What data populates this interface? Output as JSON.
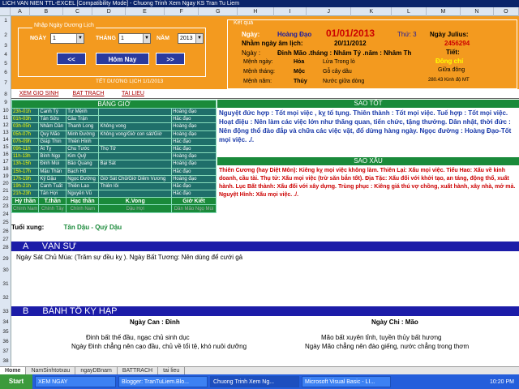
{
  "window": {
    "title": "LICH VAN NIEN TTL-EXCEL  [Compatibility Mode] - Chuong Trinh Xem Ngay KS Tran Tu Liem"
  },
  "columns": [
    "",
    "A",
    "B",
    "C",
    "D",
    "E",
    "F",
    "G",
    "H",
    "I",
    "J",
    "K",
    "L",
    "M",
    "N",
    "O"
  ],
  "rows": [
    "1",
    "2",
    "3",
    "4",
    "5",
    "6",
    "7",
    "8",
    "9",
    "10",
    "11",
    "12",
    "13",
    "14",
    "15",
    "16",
    "17",
    "18",
    "19",
    "20",
    "21",
    "22",
    "23",
    "24",
    "25",
    "26",
    "27",
    "28",
    "29",
    "30",
    "31",
    "32",
    "33",
    "34",
    "35",
    "36",
    "37",
    "38"
  ],
  "nhap": {
    "title": "Nhập Ngày Dương Lịch",
    "ngay_label": "NGÀY",
    "thang_label": "THÁNG",
    "nam_label": "NĂM",
    "ngay": "1",
    "thang": "1",
    "nam": "2013",
    "prev": "<<",
    "today": "Hôm Nay",
    "next": ">>",
    "footer": "TẾT DƯƠNG LỊCH 1/1/2013"
  },
  "ketqua": {
    "title": "Kết quả",
    "ngay_label": "Ngày:",
    "ngay_type": "Hoàng Đạo",
    "date": "01/01/2013",
    "thu": "Thứ: 3",
    "julius_label": "Ngày Julius:",
    "julius": "2456294",
    "am_label": "Nhằm ngày âm lịch:",
    "am": "20/11/2012",
    "tiet_label": "Tiết:",
    "ngay2_label": "Ngày :",
    "canchi": "Đinh Mão .tháng : Nhâm Tý .năm : Nhâm Th",
    "tiet": "Đông chí",
    "menh_ngay_label": "Mệnh ngày:",
    "menh_ngay": "Hỏa",
    "menh_ngay_v": "Lửa Trong lò",
    "giua": "Giữa đông",
    "menh_thang_label": "Mệnh tháng:",
    "menh_thang": "Mộc",
    "menh_thang_v": "Gỗ cây dâu",
    "kinhdo": "280.43 Kinh độ MT",
    "menh_nam_label": "Mệnh năm:",
    "menh_nam": "Thủy",
    "menh_nam_v": "Nước giữa dòng"
  },
  "tabs": [
    "XEM GIO SINH",
    "BAT TRACH",
    "TAI LIEU"
  ],
  "banggio": {
    "header": "BẢNG GIỜ",
    "rows": [
      [
        "23h-01h",
        "Canh Tý",
        "Tư Mệnh",
        "",
        "Hoàng đạo"
      ],
      [
        "01h-03h",
        "Tân Sửu",
        "Câu Trận",
        "",
        "Hắc đạo"
      ],
      [
        "03h-05h",
        "Nhâm Dần",
        "Thanh Long",
        "Không vong",
        "Hoàng đạo"
      ],
      [
        "05h-07h",
        "Quý Mão",
        "Minh Đường",
        "Không vong/Giờ con sát/Giờ",
        "Hoàng đạo"
      ],
      [
        "07h-09h",
        "Giáp Thìn",
        "Thiên Hình",
        "",
        "Hắc đạo"
      ],
      [
        "09h-11h",
        "Ất Tỵ",
        "Chu Tước",
        "Thọ Tử",
        "Hắc đạo"
      ],
      [
        "11h-13h",
        "Bính Ngọ",
        "Kim Quỹ",
        "",
        "Hoàng đạo"
      ],
      [
        "13h-15h",
        "Đinh Mùi",
        "Bảo Quang",
        "Bại Sát",
        "Hoàng đạo"
      ],
      [
        "15h-17h",
        "Mậu Thân",
        "Bạch Hổ",
        "",
        "Hắc đạo"
      ],
      [
        "17h-19h",
        "Kỷ Dậu",
        "Ngọc Đường",
        "Giờ Sát Chủ/Giờ Diêm Vương",
        "Hoàng đạo"
      ],
      [
        "19h-21h",
        "Canh Tuất",
        "Thiên Lao",
        "Thiên lôi",
        "Hắc đạo"
      ],
      [
        "21h-23h",
        "Tân Hợi",
        "Nguyên Vũ",
        "",
        "Hắc đạo"
      ]
    ],
    "foot": [
      "Hỷ thần",
      "T.thần",
      "Hạc thần",
      "K.Vong",
      "Giờ Kiết"
    ],
    "foot2": [
      "Chính Nam",
      "Chính Tây",
      "Chính Nam",
      "Dậu Hợi",
      "Dần Mão Ngọ Mùi"
    ]
  },
  "tuoixung": {
    "label": "Tuổi xung:",
    "value": "Tân Dậu - Quý Dậu"
  },
  "saotot": {
    "header": "SAO TỐT",
    "text": "Nguyệt đức hợp : Tốt mọi việc , kỵ tố tụng. Thiên thành : Tốt mọi việc. Tuế hợp : Tốt mọi việc. Hoạt điệu : Nên làm các việc lớn như thăng quan, tiến chức, tặng thưởng. Dân nhật, thời đức : Nên động thổ đào đắp và chữa các việc vặt, đổ dừng hàng ngày. Ngọc đường : Hoàng Đạo-Tốt mọi việc. ./."
  },
  "saoxau": {
    "header": "SAO XẤU",
    "text": "Thiên Cương (hay Diệt Môn): Kiêng kỵ mọi việc không làm. Thiên Lại: Xấu mọi việc. Tiểu Hao: Xấu về kinh doanh, cầu tài. Thụ tử: Xấu mọi việc (trừ săn bắn tốt). Địa Tặc: Xấu đối với khởi tạo, an táng, động thổ, xuất hành. Lục Bất thành: Xấu đối với xây dựng. Trùng phục : Kiêng giá thú vợ chồng, xuất hành, xây nhà, mở mả. Nguyệt Hình: Xấu mọi việc. ./."
  },
  "vansu": {
    "letter": "A",
    "title": "VẠN SỰ",
    "text": "Ngày Sát Chủ Mùa: (Trăm sự đều kỵ ). Ngày Bất Tương: Nên dùng để cưới gả"
  },
  "banh": {
    "letter": "B",
    "title": "BÀNH TỔ KỴ HẠP",
    "can_label": "Ngày Can : Đinh",
    "chi_label": "Ngày Chi : Mão",
    "can1": "Đinh bất thế đầu, ngạc chủ sinh dục",
    "can2": "Ngày Đinh chẳng nên cạo đầu, chủ về tổi tệ, khó nuôi dưỡng",
    "chi1": "Mão bất xuyên tỉnh, tuyền thủy bất hương",
    "chi2": "Ngày Mão chẳng nên đào giếng, nước chẳng trong thơm"
  },
  "sheettabs": [
    "Home",
    "NamSinhtotxau",
    "ngayDBnam",
    "BATTRACH",
    "tai lieu"
  ],
  "taskbar": {
    "start": "Start",
    "items": [
      "XEM NGAY",
      "Blogger: TranTuLiem.Blo...",
      "Chuong Trinh Xem Ng...",
      "Microsoft Visual Basic - LI..."
    ],
    "clock": "10:20 PM"
  }
}
